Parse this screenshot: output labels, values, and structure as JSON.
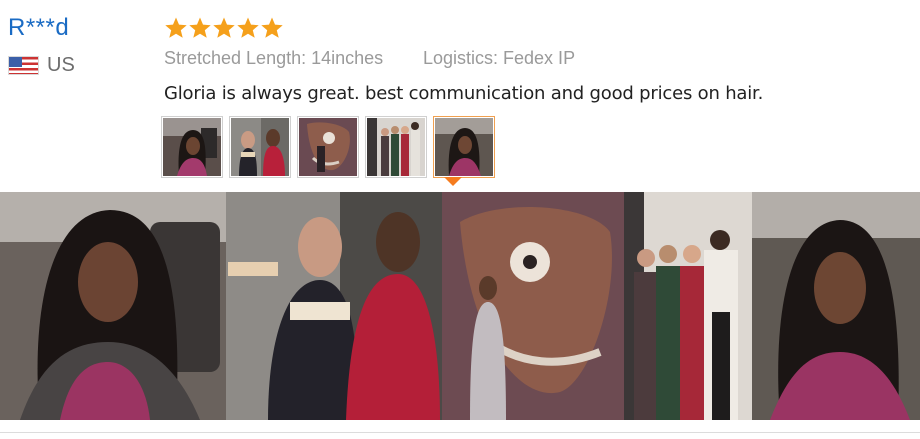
{
  "reviewer": {
    "name": "R***d",
    "country_code": "US",
    "flag_icon": "us-flag-icon"
  },
  "rating": {
    "stars": 5,
    "max": 5,
    "color": "#f5a01b"
  },
  "attributes": {
    "stretched_length": "Stretched Length: 14inches",
    "logistics": "Logistics: Fedex IP"
  },
  "review_text": "Gloria is always great. best communication and good prices on hair.",
  "photos": {
    "thumbnail_count": 5,
    "active_index": 4,
    "accent_color": "#f57c1f"
  }
}
